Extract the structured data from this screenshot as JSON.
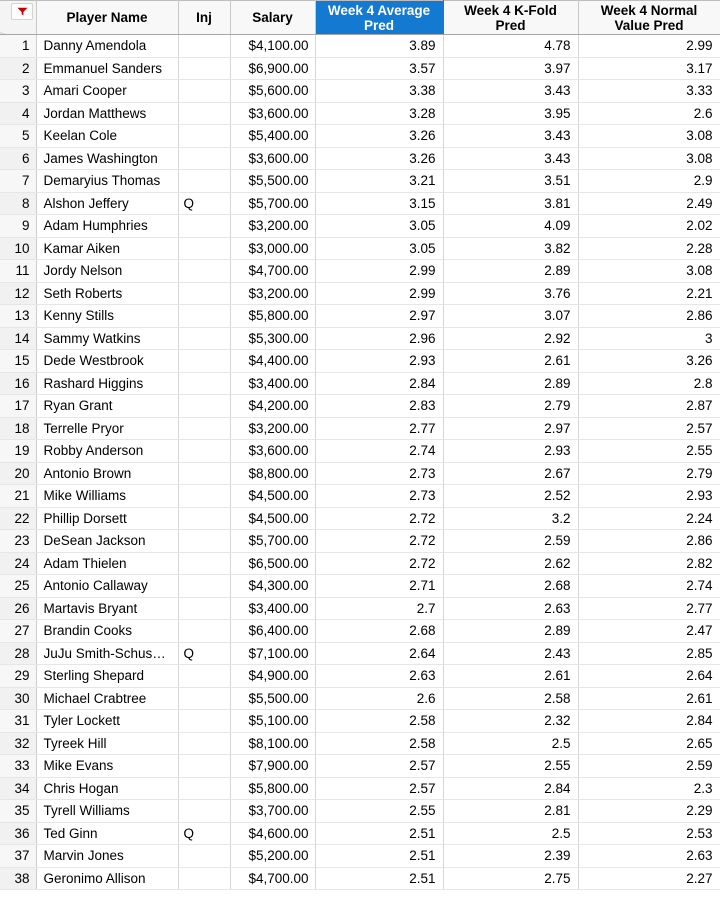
{
  "corner": {
    "filter_icon": "filter-dropdown-icon",
    "accent_color": "#c00000"
  },
  "header": {
    "accent_color": "#1479d0",
    "columns": [
      {
        "label": "",
        "key": "rownum"
      },
      {
        "label": "Player Name",
        "key": "name"
      },
      {
        "label": "Inj",
        "key": "inj"
      },
      {
        "label": "Salary",
        "key": "salary"
      },
      {
        "label": "Week 4 Average Pred",
        "key": "avg",
        "highlighted": true
      },
      {
        "label": "Week 4 K-Fold Pred",
        "key": "kfold"
      },
      {
        "label": "Week 4 Normal Value Pred",
        "key": "normal"
      }
    ]
  },
  "rows": [
    {
      "n": "1",
      "name": "Danny Amendola",
      "inj": "",
      "salary": "$4,100.00",
      "avg": "3.89",
      "kfold": "4.78",
      "normal": "2.99"
    },
    {
      "n": "2",
      "name": "Emmanuel Sanders",
      "inj": "",
      "salary": "$6,900.00",
      "avg": "3.57",
      "kfold": "3.97",
      "normal": "3.17"
    },
    {
      "n": "3",
      "name": "Amari Cooper",
      "inj": "",
      "salary": "$5,600.00",
      "avg": "3.38",
      "kfold": "3.43",
      "normal": "3.33"
    },
    {
      "n": "4",
      "name": "Jordan Matthews",
      "inj": "",
      "salary": "$3,600.00",
      "avg": "3.28",
      "kfold": "3.95",
      "normal": "2.6"
    },
    {
      "n": "5",
      "name": "Keelan Cole",
      "inj": "",
      "salary": "$5,400.00",
      "avg": "3.26",
      "kfold": "3.43",
      "normal": "3.08"
    },
    {
      "n": "6",
      "name": "James Washington",
      "inj": "",
      "salary": "$3,600.00",
      "avg": "3.26",
      "kfold": "3.43",
      "normal": "3.08"
    },
    {
      "n": "7",
      "name": "Demaryius Thomas",
      "inj": "",
      "salary": "$5,500.00",
      "avg": "3.21",
      "kfold": "3.51",
      "normal": "2.9"
    },
    {
      "n": "8",
      "name": "Alshon Jeffery",
      "inj": "Q",
      "salary": "$5,700.00",
      "avg": "3.15",
      "kfold": "3.81",
      "normal": "2.49"
    },
    {
      "n": "9",
      "name": "Adam Humphries",
      "inj": "",
      "salary": "$3,200.00",
      "avg": "3.05",
      "kfold": "4.09",
      "normal": "2.02"
    },
    {
      "n": "10",
      "name": "Kamar Aiken",
      "inj": "",
      "salary": "$3,000.00",
      "avg": "3.05",
      "kfold": "3.82",
      "normal": "2.28"
    },
    {
      "n": "11",
      "name": "Jordy Nelson",
      "inj": "",
      "salary": "$4,700.00",
      "avg": "2.99",
      "kfold": "2.89",
      "normal": "3.08"
    },
    {
      "n": "12",
      "name": "Seth Roberts",
      "inj": "",
      "salary": "$3,200.00",
      "avg": "2.99",
      "kfold": "3.76",
      "normal": "2.21"
    },
    {
      "n": "13",
      "name": "Kenny Stills",
      "inj": "",
      "salary": "$5,800.00",
      "avg": "2.97",
      "kfold": "3.07",
      "normal": "2.86"
    },
    {
      "n": "14",
      "name": "Sammy Watkins",
      "inj": "",
      "salary": "$5,300.00",
      "avg": "2.96",
      "kfold": "2.92",
      "normal": "3"
    },
    {
      "n": "15",
      "name": "Dede Westbrook",
      "inj": "",
      "salary": "$4,400.00",
      "avg": "2.93",
      "kfold": "2.61",
      "normal": "3.26"
    },
    {
      "n": "16",
      "name": "Rashard Higgins",
      "inj": "",
      "salary": "$3,400.00",
      "avg": "2.84",
      "kfold": "2.89",
      "normal": "2.8"
    },
    {
      "n": "17",
      "name": "Ryan Grant",
      "inj": "",
      "salary": "$4,200.00",
      "avg": "2.83",
      "kfold": "2.79",
      "normal": "2.87"
    },
    {
      "n": "18",
      "name": "Terrelle Pryor",
      "inj": "",
      "salary": "$3,200.00",
      "avg": "2.77",
      "kfold": "2.97",
      "normal": "2.57"
    },
    {
      "n": "19",
      "name": "Robby Anderson",
      "inj": "",
      "salary": "$3,600.00",
      "avg": "2.74",
      "kfold": "2.93",
      "normal": "2.55"
    },
    {
      "n": "20",
      "name": "Antonio Brown",
      "inj": "",
      "salary": "$8,800.00",
      "avg": "2.73",
      "kfold": "2.67",
      "normal": "2.79"
    },
    {
      "n": "21",
      "name": "Mike Williams",
      "inj": "",
      "salary": "$4,500.00",
      "avg": "2.73",
      "kfold": "2.52",
      "normal": "2.93"
    },
    {
      "n": "22",
      "name": "Phillip Dorsett",
      "inj": "",
      "salary": "$4,500.00",
      "avg": "2.72",
      "kfold": "3.2",
      "normal": "2.24"
    },
    {
      "n": "23",
      "name": "DeSean Jackson",
      "inj": "",
      "salary": "$5,700.00",
      "avg": "2.72",
      "kfold": "2.59",
      "normal": "2.86"
    },
    {
      "n": "24",
      "name": "Adam Thielen",
      "inj": "",
      "salary": "$6,500.00",
      "avg": "2.72",
      "kfold": "2.62",
      "normal": "2.82"
    },
    {
      "n": "25",
      "name": "Antonio Callaway",
      "inj": "",
      "salary": "$4,300.00",
      "avg": "2.71",
      "kfold": "2.68",
      "normal": "2.74"
    },
    {
      "n": "26",
      "name": "Martavis Bryant",
      "inj": "",
      "salary": "$3,400.00",
      "avg": "2.7",
      "kfold": "2.63",
      "normal": "2.77"
    },
    {
      "n": "27",
      "name": "Brandin Cooks",
      "inj": "",
      "salary": "$6,400.00",
      "avg": "2.68",
      "kfold": "2.89",
      "normal": "2.47"
    },
    {
      "n": "28",
      "name": "JuJu Smith-Schus…",
      "inj": "Q",
      "salary": "$7,100.00",
      "avg": "2.64",
      "kfold": "2.43",
      "normal": "2.85"
    },
    {
      "n": "29",
      "name": "Sterling Shepard",
      "inj": "",
      "salary": "$4,900.00",
      "avg": "2.63",
      "kfold": "2.61",
      "normal": "2.64"
    },
    {
      "n": "30",
      "name": "Michael Crabtree",
      "inj": "",
      "salary": "$5,500.00",
      "avg": "2.6",
      "kfold": "2.58",
      "normal": "2.61"
    },
    {
      "n": "31",
      "name": "Tyler Lockett",
      "inj": "",
      "salary": "$5,100.00",
      "avg": "2.58",
      "kfold": "2.32",
      "normal": "2.84"
    },
    {
      "n": "32",
      "name": "Tyreek Hill",
      "inj": "",
      "salary": "$8,100.00",
      "avg": "2.58",
      "kfold": "2.5",
      "normal": "2.65"
    },
    {
      "n": "33",
      "name": "Mike Evans",
      "inj": "",
      "salary": "$7,900.00",
      "avg": "2.57",
      "kfold": "2.55",
      "normal": "2.59"
    },
    {
      "n": "34",
      "name": "Chris Hogan",
      "inj": "",
      "salary": "$5,800.00",
      "avg": "2.57",
      "kfold": "2.84",
      "normal": "2.3"
    },
    {
      "n": "35",
      "name": "Tyrell Williams",
      "inj": "",
      "salary": "$3,700.00",
      "avg": "2.55",
      "kfold": "2.81",
      "normal": "2.29"
    },
    {
      "n": "36",
      "name": "Ted Ginn",
      "inj": "Q",
      "salary": "$4,600.00",
      "avg": "2.51",
      "kfold": "2.5",
      "normal": "2.53"
    },
    {
      "n": "37",
      "name": "Marvin Jones",
      "inj": "",
      "salary": "$5,200.00",
      "avg": "2.51",
      "kfold": "2.39",
      "normal": "2.63"
    },
    {
      "n": "38",
      "name": "Geronimo Allison",
      "inj": "",
      "salary": "$4,700.00",
      "avg": "2.51",
      "kfold": "2.75",
      "normal": "2.27"
    }
  ]
}
